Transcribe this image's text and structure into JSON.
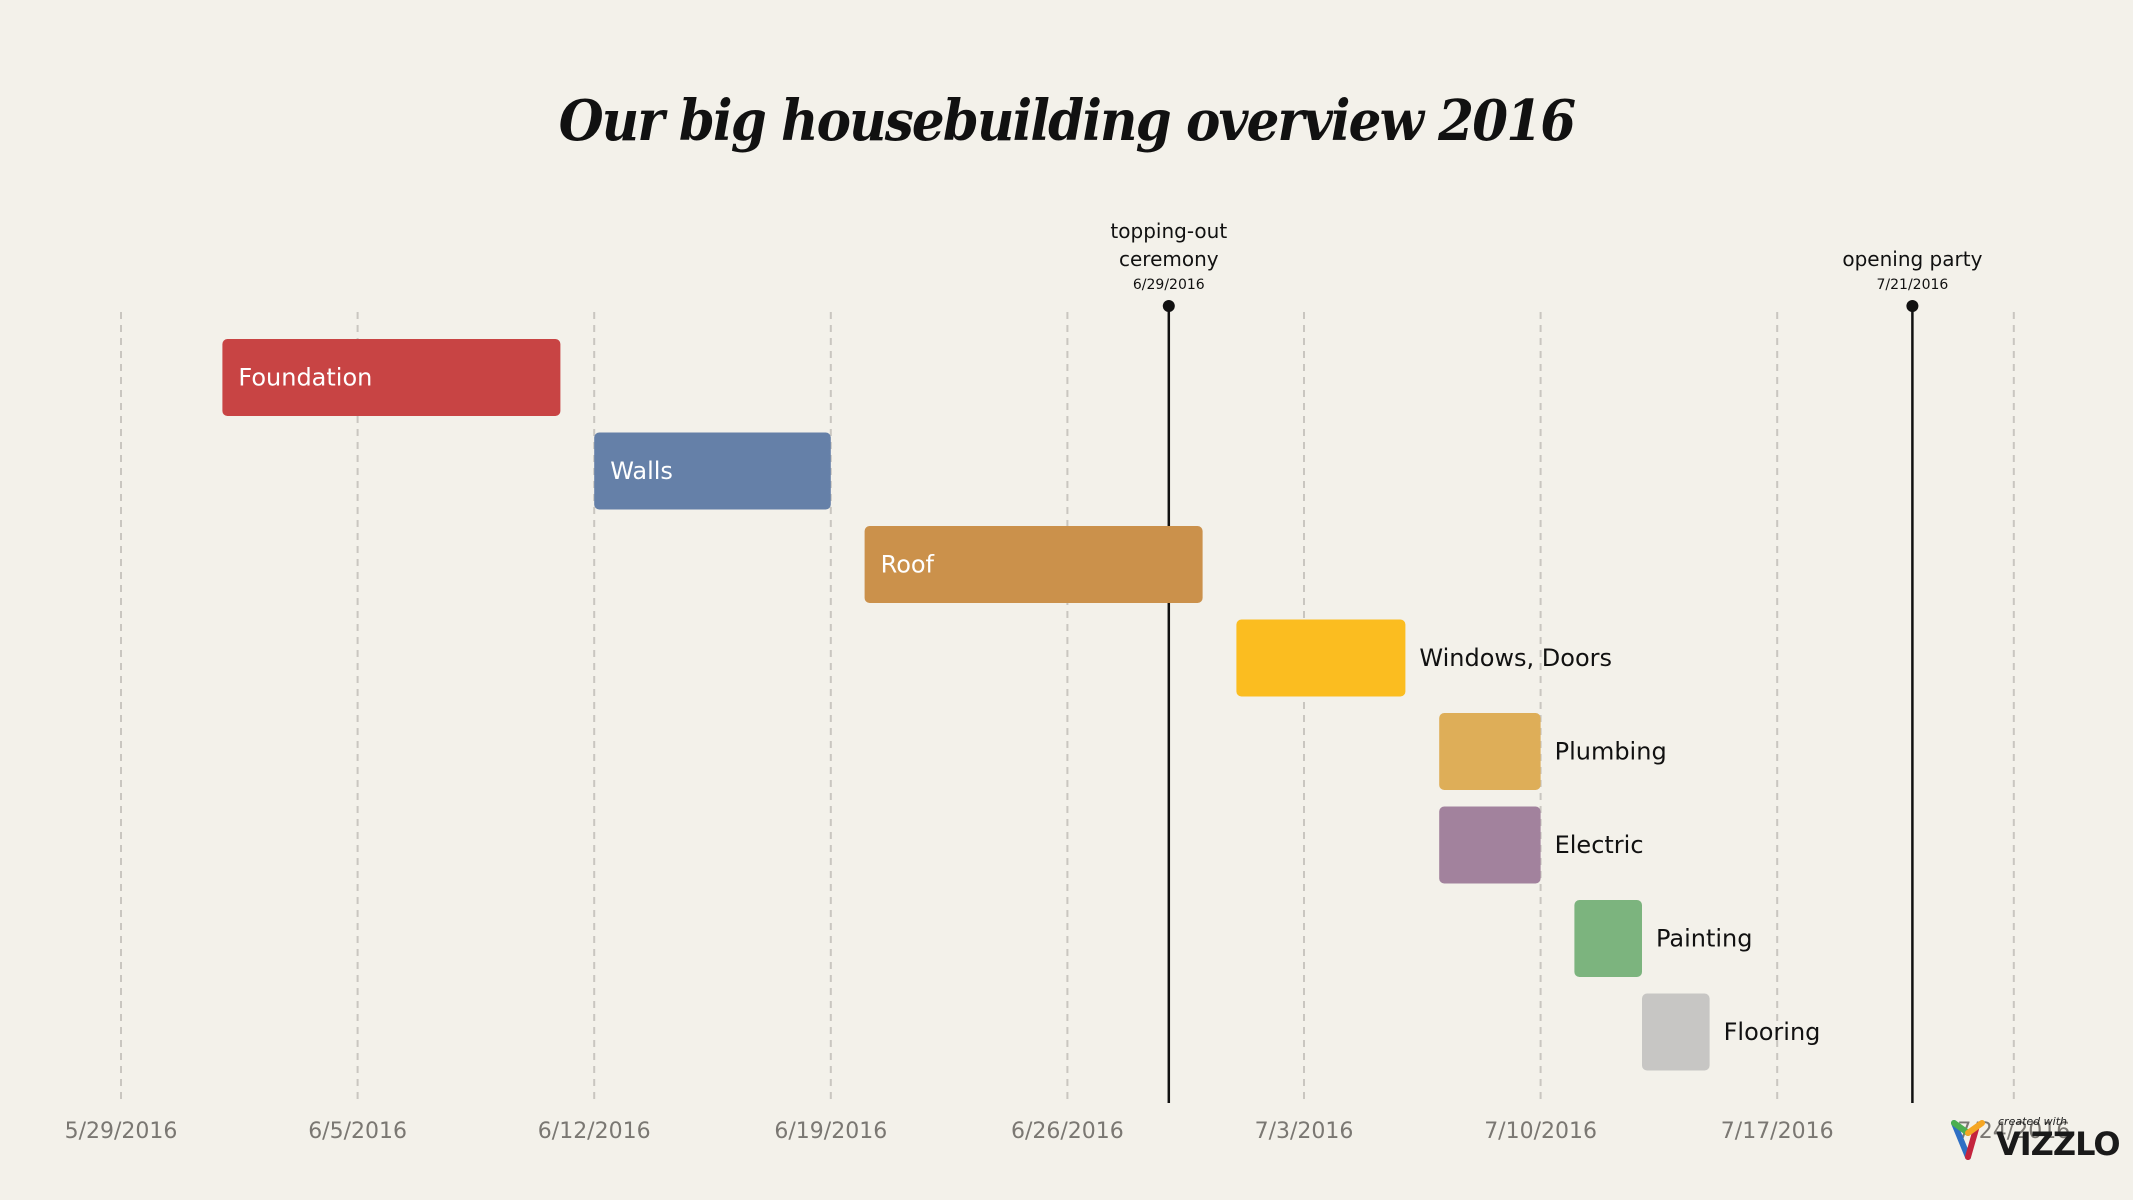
{
  "chart_data": {
    "type": "gantt",
    "title": "Our big housebuilding overview 2016",
    "x_axis": {
      "start": "2016-05-29",
      "end": "2016-07-24",
      "tick_interval_days": 7,
      "tick_labels": [
        "5/29/2016",
        "6/5/2016",
        "6/12/2016",
        "6/19/2016",
        "6/26/2016",
        "7/3/2016",
        "7/10/2016",
        "7/17/2016",
        "7/24/2016"
      ],
      "grid": true,
      "grid_style": "dashed"
    },
    "tasks": [
      {
        "name": "Foundation",
        "start": "2016-06-01",
        "end": "2016-06-11",
        "color": "#c84444",
        "label_position": "inside"
      },
      {
        "name": "Walls",
        "start": "2016-06-12",
        "end": "2016-06-19",
        "color": "#6580a8",
        "label_position": "inside"
      },
      {
        "name": "Roof",
        "start": "2016-06-20",
        "end": "2016-06-30",
        "color": "#cb914b",
        "label_position": "inside"
      },
      {
        "name": "Windows, Doors",
        "start": "2016-07-01",
        "end": "2016-07-06",
        "color": "#fbbd20",
        "label_position": "outside"
      },
      {
        "name": "Plumbing",
        "start": "2016-07-07",
        "end": "2016-07-10",
        "color": "#deae58",
        "label_position": "outside"
      },
      {
        "name": "Electric",
        "start": "2016-07-07",
        "end": "2016-07-10",
        "color": "#a2829d",
        "label_position": "outside"
      },
      {
        "name": "Painting",
        "start": "2016-07-11",
        "end": "2016-07-13",
        "color": "#7cb47e",
        "label_position": "outside"
      },
      {
        "name": "Flooring",
        "start": "2016-07-13",
        "end": "2016-07-15",
        "color": "#c7c6c4",
        "label_position": "outside"
      }
    ],
    "milestones": [
      {
        "label_lines": [
          "topping-out",
          "ceremony"
        ],
        "date": "2016-06-29",
        "date_label": "6/29/2016"
      },
      {
        "label_lines": [
          "opening party"
        ],
        "date": "2016-07-21",
        "date_label": "7/21/2016"
      }
    ]
  },
  "branding": {
    "created_with": "created with",
    "brand": "VIZZLO"
  }
}
